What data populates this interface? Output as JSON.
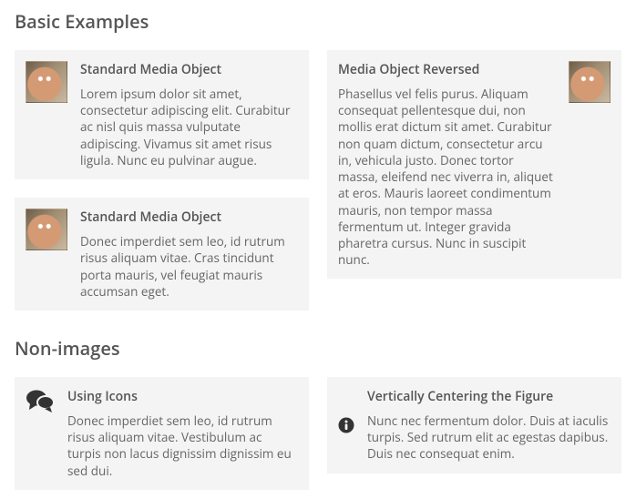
{
  "sections": {
    "basic": {
      "heading": "Basic Examples",
      "left": [
        {
          "title": "Standard Media Object",
          "body": "Lorem ipsum dolor sit amet, consectetur adipiscing elit. Curabitur ac nisl quis massa vulputate adipiscing. Vivamus sit amet risus ligula. Nunc eu pulvinar augue."
        },
        {
          "title": "Standard Media Object",
          "body": "Donec imperdiet sem leo, id rutrum risus aliquam vitae. Cras tincidunt porta mauris, vel feugiat mauris accumsan eget."
        }
      ],
      "right": [
        {
          "title": "Media Object Reversed",
          "body": "Phasellus vel felis purus. Aliquam consequat pellentesque dui, non mollis erat dictum sit amet. Curabitur non quam dictum, consectetur arcu in, vehicula justo. Donec tortor massa, eleifend nec viverra in, aliquet at eros. Mauris laoreet condimentum mauris, non tempor massa fermentum ut. Integer gravida pharetra cursus. Nunc in suscipit nunc."
        }
      ]
    },
    "nonimages": {
      "heading": "Non-images",
      "left": [
        {
          "title": "Using Icons",
          "body": "Donec imperdiet sem leo, id rutrum risus aliquam vitae. Vestibulum ac turpis non lacus dignissim dignissim eu sed dui."
        }
      ],
      "right": [
        {
          "title": "Vertically Centering the Figure",
          "body": "Nunc nec fermentum dolor. Duis at iaculis turpis. Sed rutrum elit ac egestas dapibus. Duis nec consequat enim."
        }
      ]
    }
  }
}
